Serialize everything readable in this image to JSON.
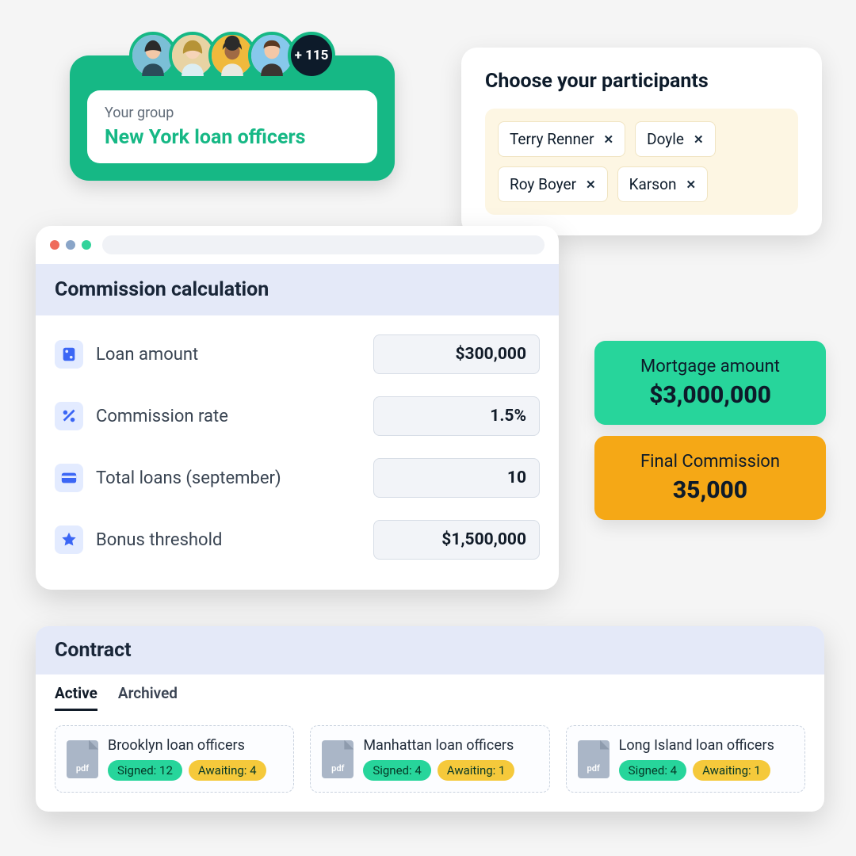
{
  "group": {
    "label": "Your group",
    "name": "New York loan officers",
    "overflow": "+ 115"
  },
  "participants": {
    "title": "Choose your participants",
    "chips": [
      "Terry Renner",
      "Doyle",
      "Roy Boyer",
      "Karson"
    ]
  },
  "calc": {
    "title": "Commission calculation",
    "rows": [
      {
        "label": "Loan amount",
        "value": "$300,000"
      },
      {
        "label": "Commission rate",
        "value": "1.5%"
      },
      {
        "label": "Total loans (september)",
        "value": "10"
      },
      {
        "label": "Bonus threshold",
        "value": "$1,500,000"
      }
    ]
  },
  "summary": {
    "mortgage": {
      "label": "Mortgage amount",
      "value": "$3,000,000"
    },
    "commission": {
      "label": "Final Commission",
      "value": "35,000"
    }
  },
  "contract": {
    "title": "Contract",
    "tabs": [
      "Active",
      "Archived"
    ],
    "pdfLabel": "pdf",
    "docs": [
      {
        "title": "Brooklyn loan officers",
        "signed": "Signed: 12",
        "awaiting": "Awaiting: 4"
      },
      {
        "title": "Manhattan loan officers",
        "signed": "Signed: 4",
        "awaiting": "Awaiting: 1"
      },
      {
        "title": "Long Island loan officers",
        "signed": "Signed: 4",
        "awaiting": "Awaiting: 1"
      }
    ]
  }
}
